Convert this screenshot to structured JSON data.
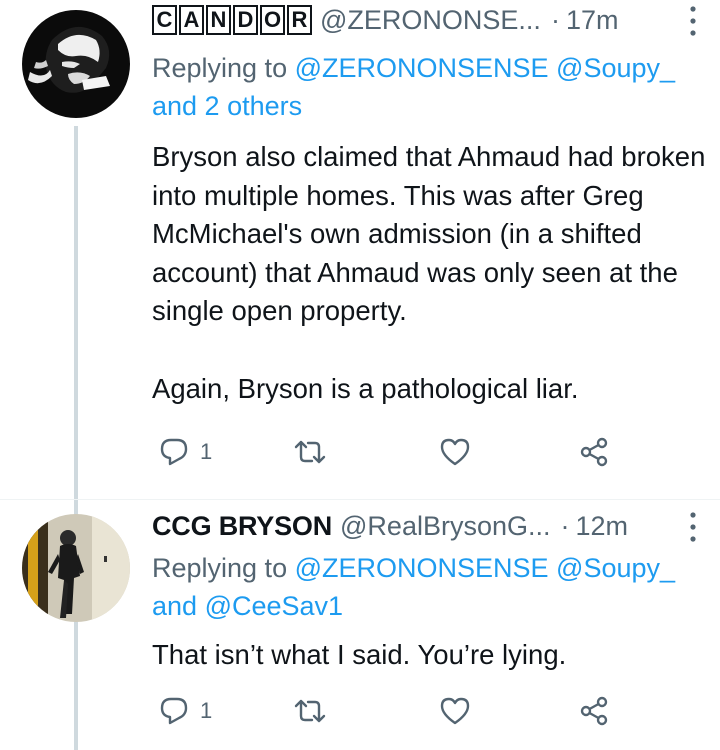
{
  "tweets": [
    {
      "display_name_letters": [
        "C",
        "A",
        "N",
        "D",
        "O",
        "R"
      ],
      "display_name": "",
      "handle": "@ZERONONSE...",
      "separator": "·",
      "time": "17m",
      "replying_prefix": "Replying to",
      "replying_mentions": "@ZERONONSENSE @Soupy_",
      "replying_line2_text": "and 2 others",
      "body": [
        "Bryson also claimed that Ahmaud had broken into multiple homes. This was after Greg McMichael's own admission (in a shifted account) that Ahmaud was only seen at the single open property.",
        "Again, Bryson is a pathological liar."
      ],
      "reply_count": "1",
      "retweet_count": "",
      "like_count": ""
    },
    {
      "display_name": "CCG BRYSON",
      "handle": "@RealBrysonG...",
      "separator": "·",
      "time": "12m",
      "replying_prefix": "Replying to",
      "replying_mentions": "@ZERONONSENSE @Soupy_",
      "replying_line2_plain": "and",
      "replying_line2_mention": "@CeeSav1",
      "body": [
        "That isn’t what I said. You’re lying."
      ],
      "reply_count": "1",
      "retweet_count": "",
      "like_count": ""
    }
  ],
  "colors": {
    "text": "#0f1419",
    "secondary": "#536471",
    "link": "#1d9bf0",
    "thread_line": "#cfd9de"
  },
  "icons": {
    "reply": "speech-bubble-icon",
    "retweet": "retweet-arrows-icon",
    "like": "heart-outline-icon",
    "share": "share-nodes-icon",
    "more": "vertical-ellipsis-icon"
  }
}
